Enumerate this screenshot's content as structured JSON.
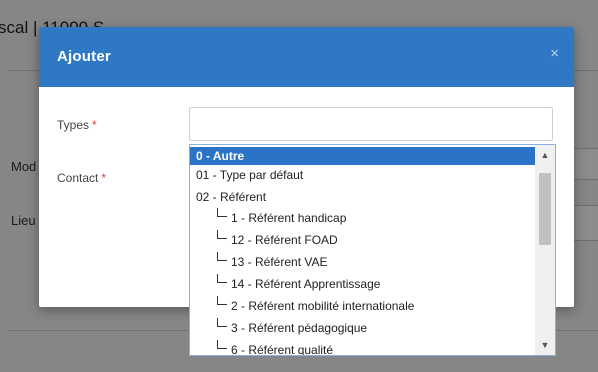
{
  "background": {
    "title": "scal | 11000 S",
    "labels": [
      "Mod",
      "Lieu"
    ]
  },
  "modal": {
    "title": "Ajouter",
    "close": "×",
    "fields": [
      {
        "label": "Types",
        "required": "*"
      },
      {
        "label": "Contact",
        "required": "*"
      }
    ]
  },
  "dropdown": {
    "options": [
      "0 - Autre",
      "01 - Type par défaut",
      "02 - Référent",
      "1 - Référent handicap",
      "12 - Référent FOAD",
      "13 - Référent VAE",
      "14 - Référent Apprentissage",
      "2 - Référent mobilité internationale",
      "3 - Référent pédagogique",
      "6 - Référent qualité"
    ],
    "selected_index": 0,
    "scroll_up": "▲",
    "scroll_down": "▼"
  }
}
